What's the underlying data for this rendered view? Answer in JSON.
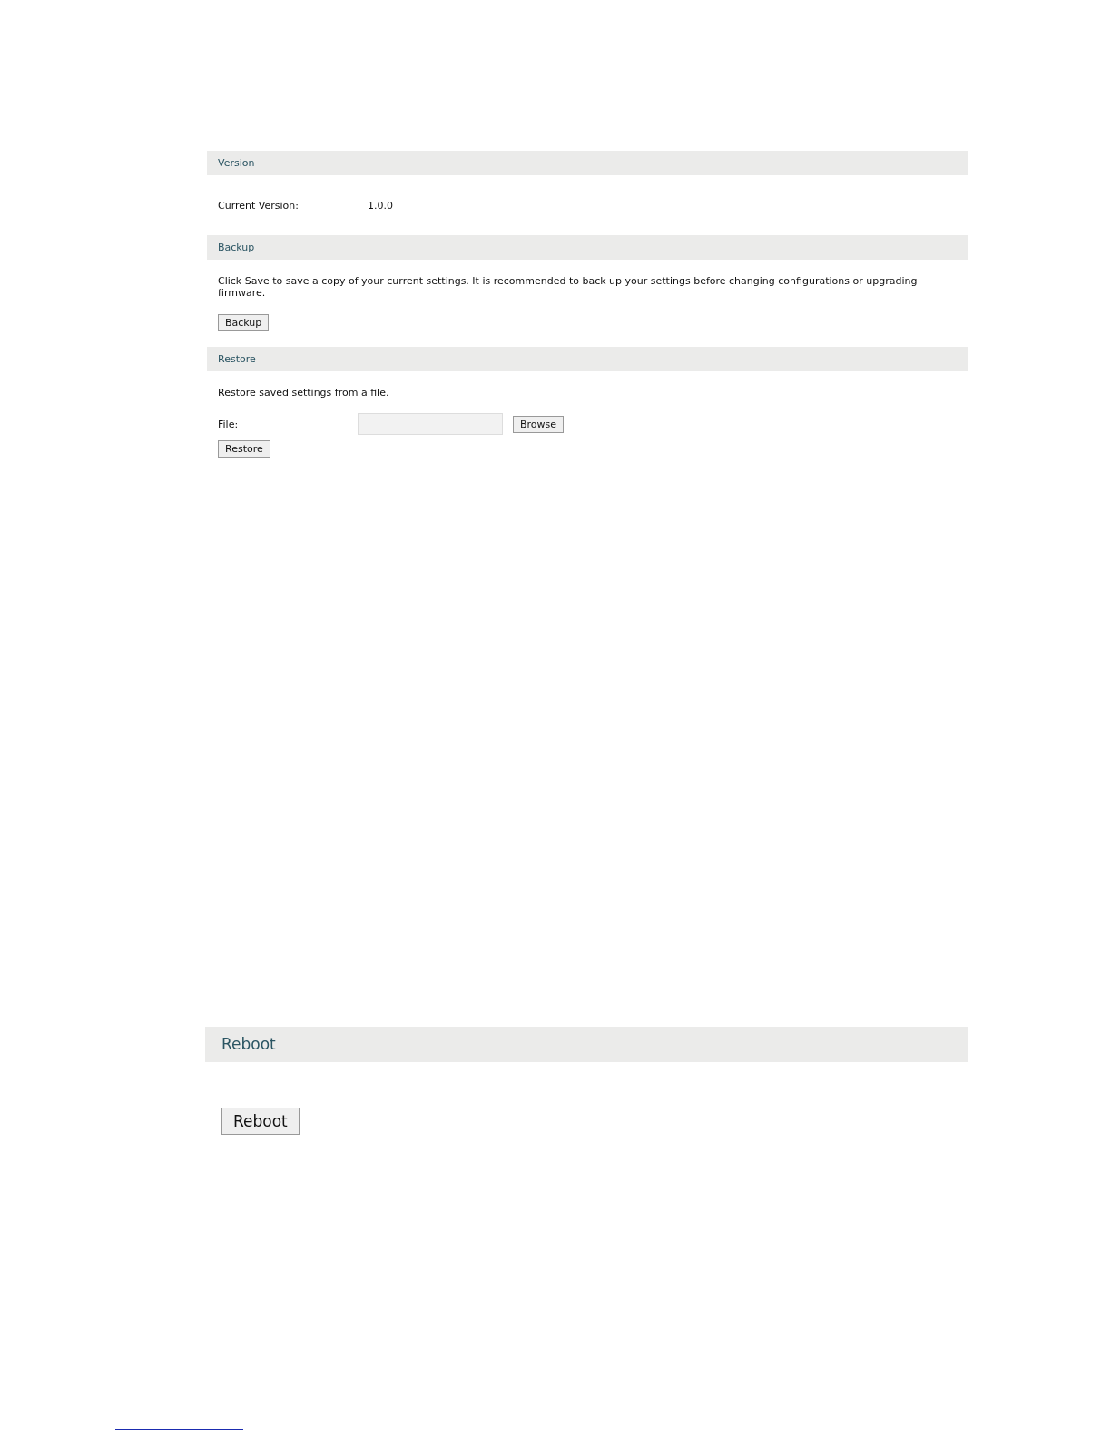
{
  "settings_panel": {
    "version": {
      "title": "Version",
      "label": "Current Version:",
      "value": "1.0.0"
    },
    "backup": {
      "title": "Backup",
      "description": "Click Save to save a copy of your current settings. It is recommended to back up your settings before changing configurations or upgrading firmware.",
      "button": "Backup"
    },
    "restore": {
      "title": "Restore",
      "description": "Restore saved settings from a file.",
      "file_label": "File:",
      "browse_button": "Browse",
      "button": "Restore"
    }
  },
  "reboot_panel": {
    "title": "Reboot",
    "button": "Reboot"
  }
}
